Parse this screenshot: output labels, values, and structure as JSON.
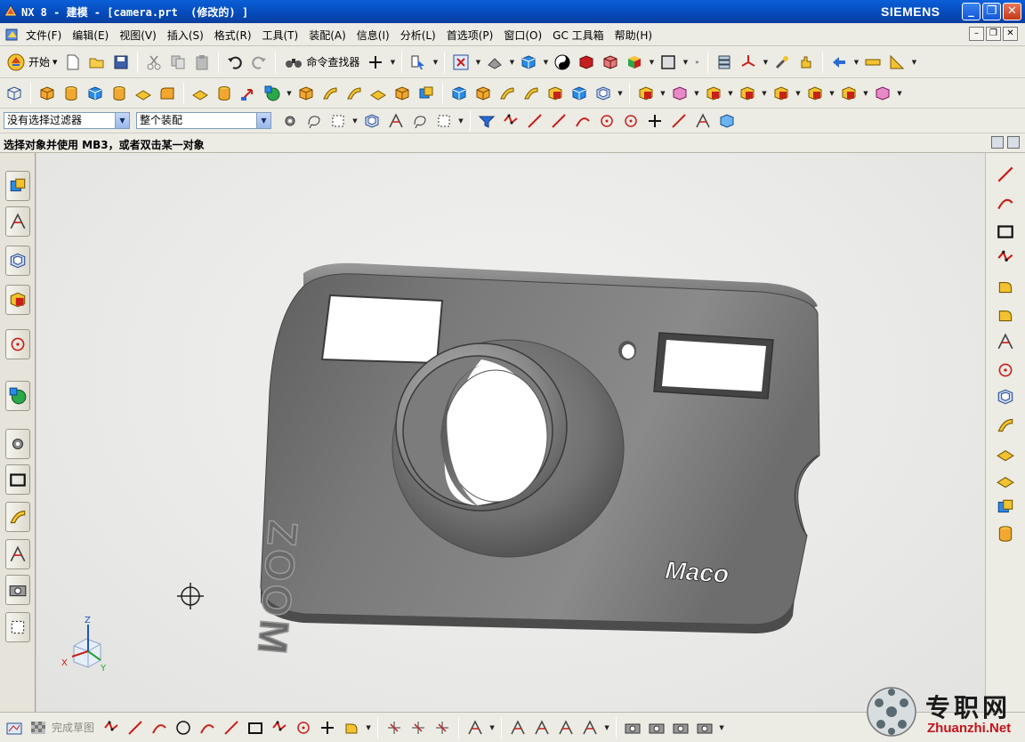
{
  "window": {
    "title": "NX 8 - 建模 - [camera.prt  (修改的) ]",
    "brand": "SIEMENS",
    "controls": [
      "_",
      "❐",
      "✕"
    ]
  },
  "menu": {
    "items": [
      "文件(F)",
      "编辑(E)",
      "视图(V)",
      "插入(S)",
      "格式(R)",
      "工具(T)",
      "装配(A)",
      "信息(I)",
      "分析(L)",
      "首选项(P)",
      "窗口(O)",
      "GC 工具箱",
      "帮助(H)"
    ],
    "mdi_controls": [
      "–",
      "❐",
      "✕"
    ]
  },
  "toolbar": {
    "start_label": "开始",
    "command_finder_label": "命令查找器"
  },
  "selection": {
    "filter_value": "没有选择过滤器",
    "scope_value": "整个装配"
  },
  "cue_line": "选择对象并使用 MB3，或者双击某一对象",
  "sketch_bar": {
    "finish_label": "完成草图"
  },
  "model": {
    "zoom_text": "ZOOM",
    "brand_text": "Maco"
  },
  "triad": {
    "x_label": "X",
    "y_label": "Y",
    "z_label": "Z"
  },
  "watermark": {
    "cn": "专职网",
    "en": "Zhuanzhi.Net"
  },
  "colors": {
    "title_blue": "#0549b9",
    "body_gray": "#6f6f6f",
    "viewport_bg": "#eaeae8",
    "watermark_red": "#c4141c"
  }
}
